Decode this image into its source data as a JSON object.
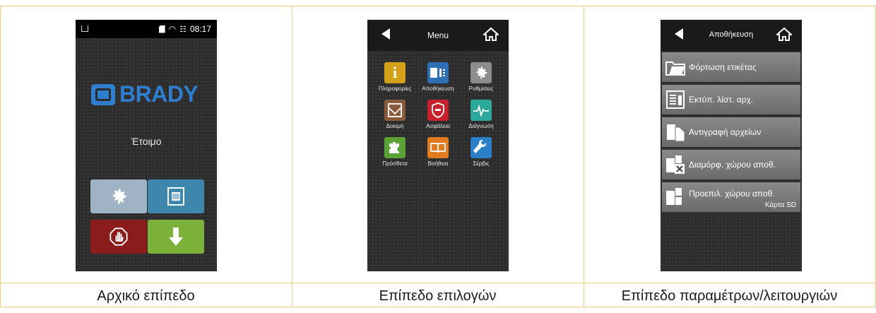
{
  "captions": [
    "Αρχικό επίπεδο",
    "Επίπεδο επιλογών",
    "Επίπεδο παραμέτρων/λειτουργιών"
  ],
  "home": {
    "time": "08:17",
    "brand": "BRADY",
    "status": "Έτοιμο",
    "colors": {
      "settings": "#9fb3c4",
      "labels": "#3d87ad",
      "stop": "#8a1c1c",
      "feed": "#7cb23a"
    }
  },
  "menu": {
    "title": "Menu",
    "items": [
      {
        "label": "Πληροφορίες",
        "icon": "info-icon",
        "color": "#d4a21a"
      },
      {
        "label": "Αποθήκευση",
        "icon": "storage-icon",
        "color": "#2c6fb5"
      },
      {
        "label": "Ρυθμίσεις",
        "icon": "gear-icon",
        "color": "#8d8d8d"
      },
      {
        "label": "Δοκιμή",
        "icon": "test-icon",
        "color": "#8a5a3d"
      },
      {
        "label": "Ασφάλεια",
        "icon": "security-icon",
        "color": "#c8202c"
      },
      {
        "label": "Διάγνωση",
        "icon": "diagnosis-icon",
        "color": "#2ba89a"
      },
      {
        "label": "Πρόσθετα",
        "icon": "puzzle-icon",
        "color": "#5aa235"
      },
      {
        "label": "Βοήθεια",
        "icon": "book-icon",
        "color": "#e07b20"
      },
      {
        "label": "Σέρβις",
        "icon": "wrench-icon",
        "color": "#2a7fc8"
      }
    ]
  },
  "storage": {
    "title": "Αποθήκευση",
    "items": [
      {
        "label": "Φόρτωση ετικέτας",
        "icon": "folder-icon"
      },
      {
        "label": "Εκτύπ. λίστ. αρχ.",
        "icon": "list-icon"
      },
      {
        "label": "Αντιγραφή αρχείων",
        "icon": "copy-icon"
      },
      {
        "label": "Διαμόρφ. χώρου αποθ.",
        "icon": "format-icon"
      },
      {
        "label": "Προεπιλ. χώρου αποθ.",
        "icon": "sdcard-icon",
        "sub": "Κάρτα SD"
      }
    ]
  }
}
